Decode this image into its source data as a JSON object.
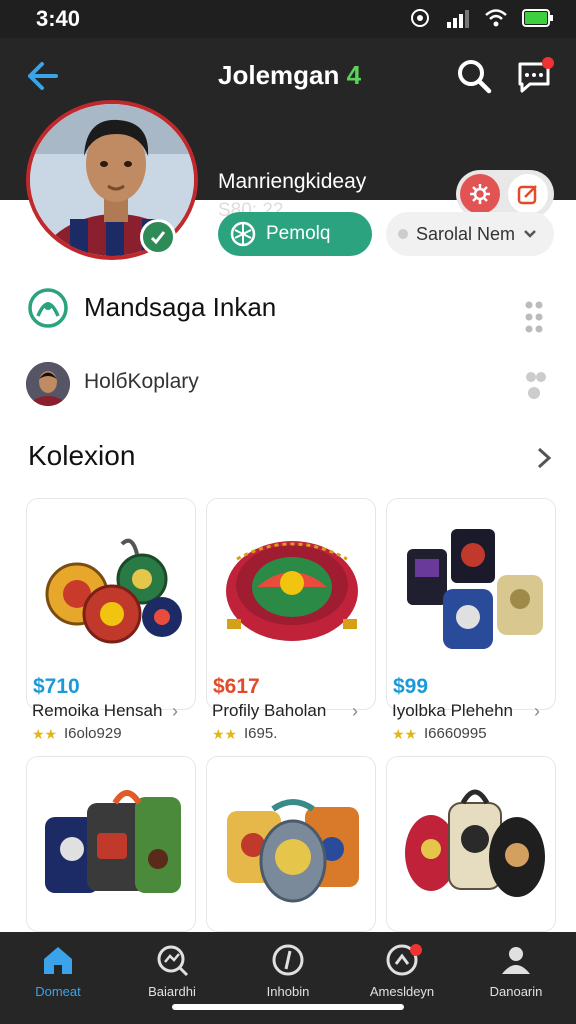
{
  "status_bar": {
    "time": "3:40"
  },
  "header": {
    "title_text": "Jolemgan",
    "title_count": "4",
    "user_name": "Manriengkideay",
    "user_sub": "S80: 22"
  },
  "actions": {
    "primary_label": "Pemolq",
    "secondary_label": "Sarolal Nem"
  },
  "info": {
    "row1_label": "Mandsaga Inkan",
    "row2_label": "HolбKoplary"
  },
  "section": {
    "title": "Kolexion"
  },
  "products": [
    {
      "price": "$710",
      "name": "Remoika Hensah",
      "count": "I6olo929",
      "price_color": "#1a9bd7"
    },
    {
      "price": "$617",
      "name": "Profily Baholan",
      "count": "I695.",
      "price_color": "#e14b2b"
    },
    {
      "price": "$99",
      "name": "Iyolbka Plehehn",
      "count": "I6660995",
      "price_color": "#1a9bd7"
    },
    {
      "price": "",
      "name": "",
      "count": "",
      "price_color": "#1a9bd7"
    },
    {
      "price": "",
      "name": "",
      "count": "",
      "price_color": "#1a9bd7"
    },
    {
      "price": "",
      "name": "",
      "count": "",
      "price_color": "#1a9bd7"
    }
  ],
  "bottom_nav": [
    {
      "label": "Domeat",
      "icon": "home-icon"
    },
    {
      "label": "Baiardhi",
      "icon": "search-icon"
    },
    {
      "label": "Inhobin",
      "icon": "compass-icon"
    },
    {
      "label": "Amesldeyn",
      "icon": "chat-icon"
    },
    {
      "label": "Danoarin",
      "icon": "person-icon"
    }
  ],
  "colors": {
    "header_bg": "#262626",
    "accent_blue": "#3ba3e9",
    "accent_green": "#2aa37e",
    "title_number": "#5bd35b"
  }
}
